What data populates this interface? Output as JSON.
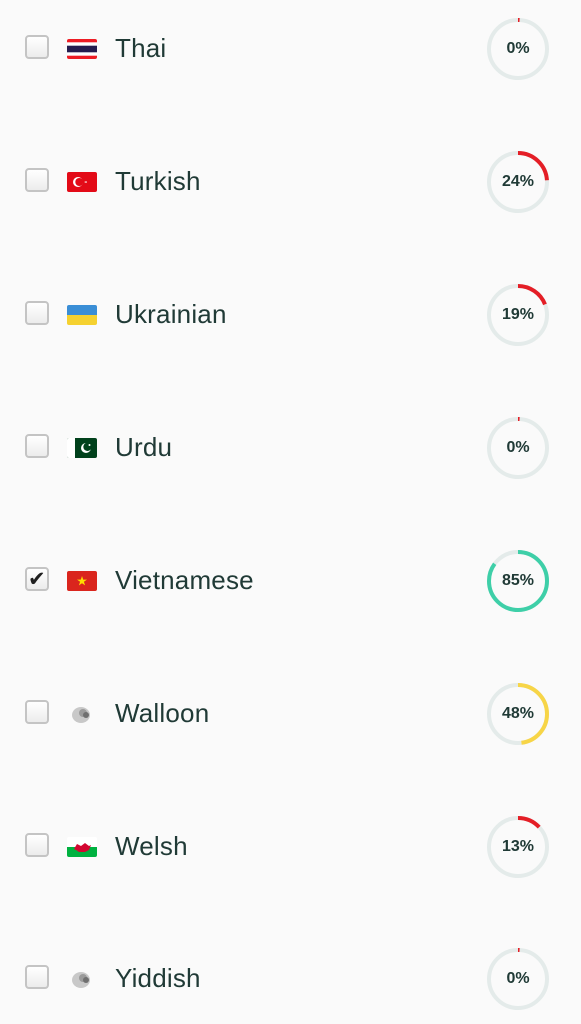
{
  "languages": [
    {
      "name": "Thai",
      "flag": "thailand-flag",
      "checked": false,
      "percent_label": "0%",
      "progress": 0,
      "color": "#e41e26"
    },
    {
      "name": "Turkish",
      "flag": "turkey-flag",
      "checked": false,
      "percent_label": "24%",
      "progress": 0.24,
      "color": "#e41e26"
    },
    {
      "name": "Ukrainian",
      "flag": "ukraine-flag",
      "checked": false,
      "percent_label": "19%",
      "progress": 0.19,
      "color": "#e41e26"
    },
    {
      "name": "Urdu",
      "flag": "pakistan-flag",
      "checked": false,
      "percent_label": "0%",
      "progress": 0,
      "color": "#e41e26"
    },
    {
      "name": "Vietnamese",
      "flag": "vietnam-flag",
      "checked": true,
      "percent_label": "85%",
      "progress": 0.85,
      "color": "#3ecfa8"
    },
    {
      "name": "Walloon",
      "flag": "generic-language-icon",
      "checked": false,
      "percent_label": "48%",
      "progress": 0.48,
      "color": "#f7d547"
    },
    {
      "name": "Welsh",
      "flag": "wales-flag",
      "checked": false,
      "percent_label": "13%",
      "progress": 0.13,
      "color": "#e41e26"
    },
    {
      "name": "Yiddish",
      "flag": "generic-language-icon",
      "checked": false,
      "percent_label": "0%",
      "progress": 0,
      "color": "#e41e26"
    }
  ],
  "colors": {
    "track": "#e4ebea",
    "text": "#203a36"
  }
}
